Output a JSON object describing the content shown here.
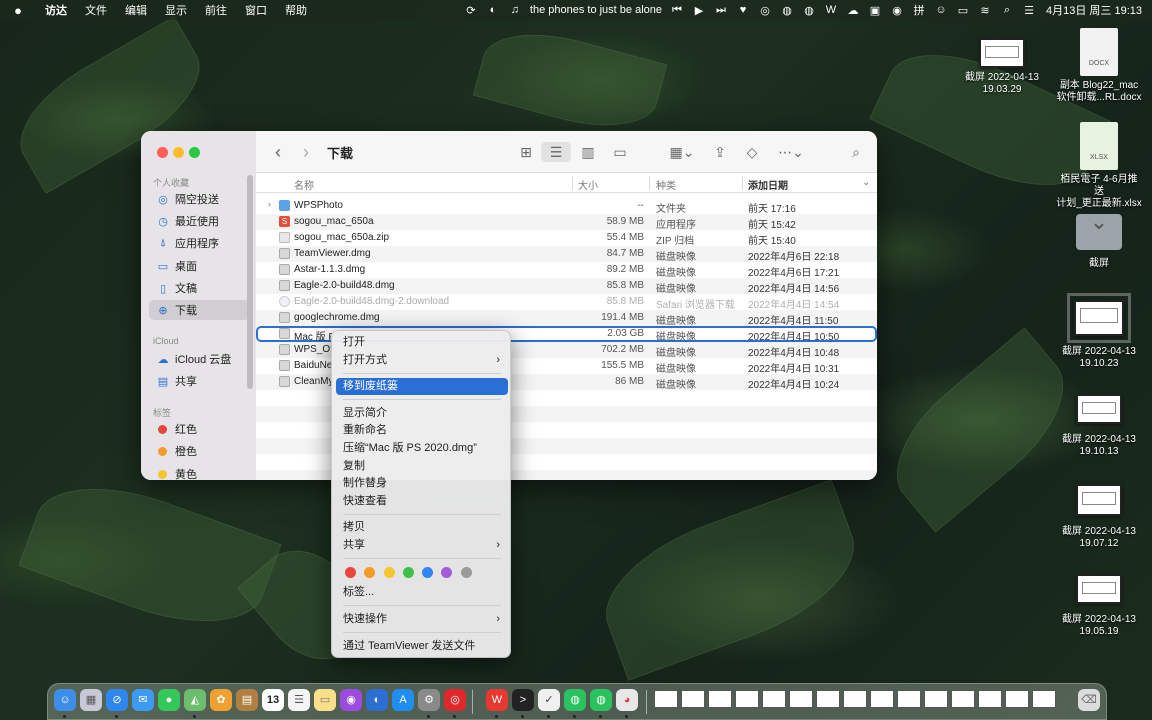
{
  "menubar": {
    "apple_icon": "apple-logo-icon",
    "items": [
      "访达",
      "文件",
      "编辑",
      "显示",
      "前往",
      "窗口",
      "帮助"
    ],
    "now_playing": "the phones to just be alone",
    "clock": "4月13日 周三  19:13"
  },
  "desktop": {
    "items": [
      {
        "label1": "截屏 2022-04-13",
        "label2": "19.03.29",
        "kind": "screenshot"
      },
      {
        "label1": "副本 Blog22_mac",
        "label2": "软件卸载...RL.docx",
        "kind": "docx",
        "badge": "DOCX"
      },
      {
        "label1": "栢民電子 4-6月推送",
        "label2": "计划_更正最新.xlsx",
        "kind": "xlsx",
        "badge": "XLSX"
      },
      {
        "label1": "截屏",
        "label2": "",
        "kind": "folder"
      },
      {
        "label1": "截屏 2022-04-13",
        "label2": "19.10.23",
        "kind": "screenshot",
        "selected": true
      },
      {
        "label1": "截屏 2022-04-13",
        "label2": "19.10.13",
        "kind": "screenshot"
      },
      {
        "label1": "截屏 2022-04-13",
        "label2": "19.07.12",
        "kind": "screenshot"
      },
      {
        "label1": "截屏 2022-04-13",
        "label2": "19.05.19",
        "kind": "screenshot"
      }
    ]
  },
  "finder": {
    "title": "下载",
    "sidebar": {
      "favorites_header": "个人收藏",
      "favorites": [
        {
          "label": "隔空投送",
          "icon": "airdrop-icon",
          "glyph": "◎"
        },
        {
          "label": "最近使用",
          "icon": "clock-icon",
          "glyph": "◷"
        },
        {
          "label": "应用程序",
          "icon": "applications-icon",
          "glyph": "⍋"
        },
        {
          "label": "桌面",
          "icon": "desktop-icon",
          "glyph": "▭"
        },
        {
          "label": "文稿",
          "icon": "document-icon",
          "glyph": "▯"
        },
        {
          "label": "下载",
          "icon": "download-icon",
          "glyph": "⊕"
        }
      ],
      "icloud_header": "iCloud",
      "icloud": [
        {
          "label": "iCloud 云盘",
          "icon": "cloud-icon",
          "glyph": "☁"
        },
        {
          "label": "共享",
          "icon": "shared-folder-icon",
          "glyph": "▤"
        }
      ],
      "tags_header": "标签",
      "tags": [
        {
          "label": "红色",
          "color": "#e8453c"
        },
        {
          "label": "橙色",
          "color": "#f39a2b"
        },
        {
          "label": "黄色",
          "color": "#f5c531"
        }
      ]
    },
    "columns": {
      "name": "名称",
      "size": "大小",
      "kind": "种类",
      "date": "添加日期"
    },
    "files": [
      {
        "name": "WPSPhoto",
        "size": "--",
        "kind": "文件夹",
        "date": "前天 17:16",
        "type": "folder",
        "disclosure": true
      },
      {
        "name": "sogou_mac_650a",
        "size": "58.9 MB",
        "kind": "应用程序",
        "date": "前天 15:42",
        "type": "app"
      },
      {
        "name": "sogou_mac_650a.zip",
        "size": "55.4 MB",
        "kind": "ZIP 归档",
        "date": "前天 15:40",
        "type": "zip"
      },
      {
        "name": "TeamViewer.dmg",
        "size": "84.7 MB",
        "kind": "磁盘映像",
        "date": "2022年4月6日 22:18",
        "type": "dmg"
      },
      {
        "name": "Astar-1.1.3.dmg",
        "size": "89.2 MB",
        "kind": "磁盘映像",
        "date": "2022年4月6日 17:21",
        "type": "dmg"
      },
      {
        "name": "Eagle-2.0-build48.dmg",
        "size": "85.8 MB",
        "kind": "磁盘映像",
        "date": "2022年4月4日 14:56",
        "type": "dmg"
      },
      {
        "name": "Eagle-2.0-build48.dmg-2.download",
        "size": "85.8 MB",
        "kind": "Safari 浏览器下载",
        "date": "2022年4月4日 14:54",
        "type": "dl",
        "dim": true
      },
      {
        "name": "googlechrome.dmg",
        "size": "191.4 MB",
        "kind": "磁盘映像",
        "date": "2022年4月4日 11:50",
        "type": "dmg"
      },
      {
        "name": "Mac 版 P",
        "size": "2.03 GB",
        "kind": "磁盘映像",
        "date": "2022年4月4日 10:50",
        "type": "dmg",
        "focus": true
      },
      {
        "name": "WPS_Of",
        "size": "702.2 MB",
        "kind": "磁盘映像",
        "date": "2022年4月4日 10:48",
        "type": "dmg"
      },
      {
        "name": "BaiduNe",
        "size": "155.5 MB",
        "kind": "磁盘映像",
        "date": "2022年4月4日 10:31",
        "type": "dmg"
      },
      {
        "name": "CleanMy",
        "size": "86 MB",
        "kind": "磁盘映像",
        "date": "2022年4月4日 10:24",
        "type": "dmg"
      }
    ]
  },
  "context_menu": {
    "open": "打开",
    "open_with": "打开方式",
    "move_to_trash": "移到废纸篓",
    "get_info": "显示简介",
    "rename": "重新命名",
    "compress": "压缩“Mac 版 PS 2020.dmg”",
    "duplicate": "复制",
    "make_alias": "制作替身",
    "quick_look": "快速查看",
    "copy": "拷贝",
    "share": "共享",
    "tags_label": "标签...",
    "quick_actions": "快速操作",
    "teamviewer": "通过 TeamViewer 发送文件",
    "tag_colors": [
      "#e8453c",
      "#f39a2b",
      "#f5c531",
      "#3cc24a",
      "#2f86f0",
      "#a45ad9",
      "#9a9a9a"
    ]
  },
  "dock": {
    "calendar_day": "13",
    "apps": [
      {
        "name": "finder-icon",
        "color": "#3d8ee8",
        "glyph": "☺"
      },
      {
        "name": "launchpad-icon",
        "color": "#d8d8e8",
        "glyph": "▦"
      },
      {
        "name": "safari-icon",
        "color": "#2f86f0",
        "glyph": "⊘"
      },
      {
        "name": "mail-icon",
        "color": "#3c9af0",
        "glyph": "✉"
      },
      {
        "name": "messages-icon",
        "color": "#34c759",
        "glyph": "●"
      },
      {
        "name": "maps-icon",
        "color": "#6cbd6c",
        "glyph": "◭"
      },
      {
        "name": "photos-icon",
        "color": "#f0a030",
        "glyph": "✿"
      },
      {
        "name": "notes-app-icon",
        "color": "#b08040",
        "glyph": "▤"
      },
      {
        "name": "calendar-icon",
        "color": "#ffffff",
        "glyph": ""
      },
      {
        "name": "reminders-icon",
        "color": "#f4f4f4",
        "glyph": "☰"
      },
      {
        "name": "notes-icon",
        "color": "#f8e08a",
        "glyph": "▭"
      },
      {
        "name": "podcasts-icon",
        "color": "#9b4be0",
        "glyph": "◉"
      },
      {
        "name": "browser-icon",
        "color": "#2c6fd1",
        "glyph": "◐"
      },
      {
        "name": "app-store-icon",
        "color": "#1f8ef0",
        "glyph": "A"
      },
      {
        "name": "settings-icon",
        "color": "#8a8a8a",
        "glyph": "⚙"
      },
      {
        "name": "netease-music-icon",
        "color": "#e0282c",
        "glyph": "◎"
      },
      {
        "name": "wps-icon",
        "color": "#e8382f",
        "glyph": "W"
      },
      {
        "name": "terminal-icon",
        "color": "#222222",
        "glyph": ">"
      },
      {
        "name": "task-app-icon",
        "color": "#f0f0f0",
        "glyph": "✓"
      },
      {
        "name": "wechat-icon",
        "color": "#2ac15f",
        "glyph": "◍"
      },
      {
        "name": "wechat-work-icon",
        "color": "#2ac15f",
        "glyph": "◍"
      },
      {
        "name": "chrome-icon",
        "color": "#e8e8e8",
        "glyph": "◕"
      }
    ],
    "trash_icon": "trash-icon"
  }
}
